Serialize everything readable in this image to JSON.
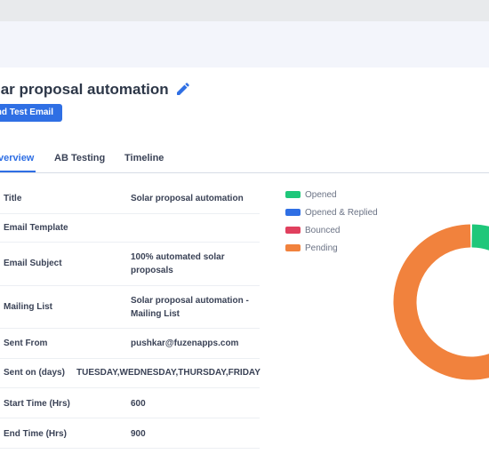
{
  "campaign": {
    "title": "lar proposal automation",
    "send_test_label": "nd Test Email"
  },
  "tabs": [
    {
      "label": "verview",
      "active": true
    },
    {
      "label": "AB Testing",
      "active": false
    },
    {
      "label": "Timeline",
      "active": false
    }
  ],
  "details": [
    {
      "label": "Title",
      "value": "Solar proposal automation"
    },
    {
      "label": "Email Template",
      "value": ""
    },
    {
      "label": "Email Subject",
      "value": "100% automated solar proposals"
    },
    {
      "label": "Mailing List",
      "value": "Solar proposal automation - Mailing List"
    },
    {
      "label": "Sent From",
      "value": "pushkar@fuzenapps.com"
    },
    {
      "label": "Sent on (days)",
      "value": "TUESDAY,WEDNESDAY,THURSDAY,FRIDAY"
    },
    {
      "label": "Start Time (Hrs)",
      "value": "600"
    },
    {
      "label": "End Time (Hrs)",
      "value": "900"
    }
  ],
  "chart_data": {
    "type": "pie",
    "legend_placement": "top-left",
    "series": [
      {
        "name": "Opened",
        "color": "#1fc77a",
        "value": 22
      },
      {
        "name": "Opened & Replied",
        "color": "#2f6fe4",
        "value": 0
      },
      {
        "name": "Bounced",
        "color": "#e0405e",
        "value": 2
      },
      {
        "name": "Pending",
        "color": "#f1823d",
        "value": 76
      }
    ]
  },
  "colors": {
    "accent": "#2f6fe4",
    "text": "#2d3748"
  }
}
